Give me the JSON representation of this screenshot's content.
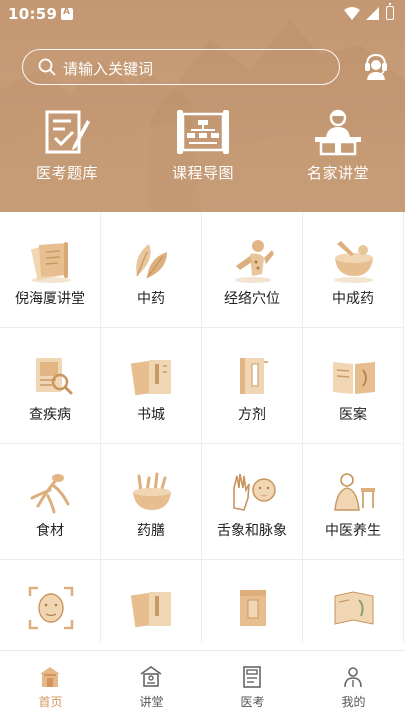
{
  "status_bar": {
    "time": "10:59"
  },
  "search": {
    "placeholder": "请输入关键词"
  },
  "top_nav": [
    {
      "label": "医考题库",
      "icon": "exam-icon"
    },
    {
      "label": "课程导图",
      "icon": "scroll-map-icon"
    },
    {
      "label": "名家讲堂",
      "icon": "lecturer-icon"
    }
  ],
  "grid": [
    {
      "label": "倪海厦讲堂",
      "icon": "scroll-icon"
    },
    {
      "label": "中药",
      "icon": "herb-leaves-icon"
    },
    {
      "label": "经络穴位",
      "icon": "meridian-figure-icon"
    },
    {
      "label": "中成药",
      "icon": "mortar-icon"
    },
    {
      "label": "查疾病",
      "icon": "disease-search-icon"
    },
    {
      "label": "书城",
      "icon": "books-icon"
    },
    {
      "label": "方剂",
      "icon": "prescription-book-icon"
    },
    {
      "label": "医案",
      "icon": "open-book-icon"
    },
    {
      "label": "食材",
      "icon": "ginseng-icon"
    },
    {
      "label": "药膳",
      "icon": "herbal-bowl-icon"
    },
    {
      "label": "舌象和脉象",
      "icon": "hand-face-icon"
    },
    {
      "label": "中医养生",
      "icon": "sage-icon"
    },
    {
      "label": "",
      "icon": "face-scan-icon"
    },
    {
      "label": "",
      "icon": "classics-book-icon"
    },
    {
      "label": "",
      "icon": "herb-box-icon"
    },
    {
      "label": "",
      "icon": "herb-book-icon"
    }
  ],
  "tabbar": [
    {
      "label": "首页",
      "icon": "home-icon",
      "active": true
    },
    {
      "label": "讲堂",
      "icon": "lecture-hall-icon"
    },
    {
      "label": "医考",
      "icon": "exam-paper-icon"
    },
    {
      "label": "我的",
      "icon": "profile-icon"
    }
  ],
  "colors": {
    "header_bg": "#c39771",
    "accent": "#d2955b",
    "icon_tan": "#e3b98a"
  }
}
